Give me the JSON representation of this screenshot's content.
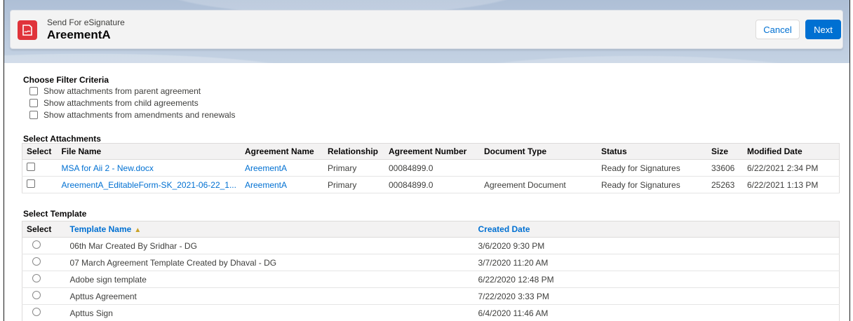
{
  "header": {
    "subtitle": "Send For eSignature",
    "title": "AreementA",
    "cancel_label": "Cancel",
    "next_label": "Next",
    "icon": "esignature-icon",
    "icon_color": "#e0343b"
  },
  "filters": {
    "title": "Choose Filter Criteria",
    "options": [
      "Show attachments from parent agreement",
      "Show attachments from child agreements",
      "Show attachments from amendments and renewals"
    ]
  },
  "attachments": {
    "title": "Select Attachments",
    "columns": [
      "Select",
      "File Name",
      "Agreement Name",
      "Relationship",
      "Agreement Number",
      "Document Type",
      "Status",
      "Size",
      "Modified Date"
    ],
    "rows": [
      {
        "file_name": "MSA for Aii 2 - New.docx",
        "agreement_name": "AreementA",
        "relationship": "Primary",
        "agreement_number": "00084899.0",
        "document_type": "",
        "status": "Ready for Signatures",
        "size": "33606",
        "modified_date": "6/22/2021 2:34 PM"
      },
      {
        "file_name": "AreementA_EditableForm-SK_2021-06-22_1...",
        "agreement_name": "AreementA",
        "relationship": "Primary",
        "agreement_number": "00084899.0",
        "document_type": "Agreement Document",
        "status": "Ready for Signatures",
        "size": "25263",
        "modified_date": "6/22/2021 1:13 PM"
      }
    ]
  },
  "templates": {
    "title": "Select Template",
    "columns": [
      "Select",
      "Template Name",
      "Created Date"
    ],
    "sort_icon": "sort-ascending-icon",
    "rows": [
      {
        "name": "06th Mar Created By Sridhar - DG",
        "created": "3/6/2020 9:30 PM"
      },
      {
        "name": "07 March Agreement Template Created by Dhaval - DG",
        "created": "3/7/2020 11:20 AM"
      },
      {
        "name": "Adobe sign template",
        "created": "6/22/2020 12:48 PM"
      },
      {
        "name": "Apttus Agreement",
        "created": "7/22/2020 3:33 PM"
      },
      {
        "name": "Apttus Sign",
        "created": "6/4/2020 11:46 AM"
      }
    ]
  },
  "colors": {
    "link": "#0070d2",
    "primary_button": "#0070d2"
  }
}
